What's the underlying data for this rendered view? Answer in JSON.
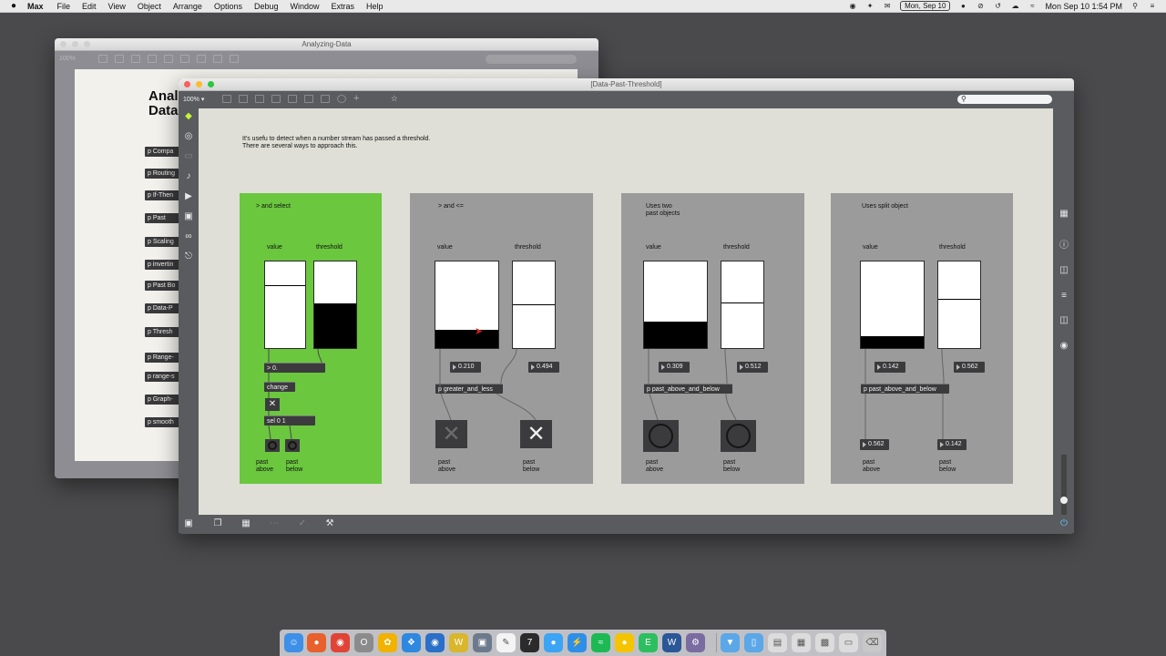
{
  "menubar": {
    "apple": "",
    "app": "Max",
    "items": [
      "File",
      "Edit",
      "View",
      "Object",
      "Arrange",
      "Options",
      "Debug",
      "Window",
      "Extras",
      "Help"
    ],
    "date_badge": "Mon, Sep 10",
    "clock": "Mon Sep 10  1:54 PM"
  },
  "bg_window": {
    "title": "Analyzing-Data",
    "zoom": "100%",
    "heading_line1": "Anal",
    "heading_line2": "Data",
    "objects": [
      "p Compa",
      "p Routing",
      "p If-Then",
      "p Past",
      "p Scaling",
      "p invertin",
      "p Past Bo",
      "p Data-P",
      "p Thresh",
      "p Range-",
      "p range-s",
      "p Graph-",
      "p smooth"
    ]
  },
  "main_window": {
    "title": "[Data-Past-Threshold]",
    "zoom": "100% ▾",
    "intro_line1": "It's usefu to detect when a number stream has passed a threshold.",
    "intro_line2": "There are several ways to approach this.",
    "panels": [
      {
        "title": "> and select",
        "value_label": "value",
        "threshold_label": "threshold",
        "value_level": 0.72,
        "threshold_level": 0.52,
        "gt_box": "> 0.",
        "change_box": "change",
        "toggle": "✕",
        "sel_box": "sel 0 1",
        "above_label": "past\nabove",
        "below_label": "past\nbelow"
      },
      {
        "title": "> and <=",
        "value_label": "value",
        "threshold_label": "threshold",
        "value_level": 0.21,
        "threshold_level": 0.494,
        "value_num": "0.210",
        "threshold_num": "0.494",
        "object": "p greater_and_less",
        "above_symbol": "✕",
        "below_symbol": "✕",
        "above_label": "past\nabove",
        "below_label": "past\nbelow"
      },
      {
        "title": "Uses two\npast objects",
        "value_label": "value",
        "threshold_label": "threshold",
        "value_level": 0.309,
        "threshold_level": 0.512,
        "value_num": "0.309",
        "threshold_num": "0.512",
        "object": "p past_above_and_below",
        "above_label": "past\nabove",
        "below_label": "past\nbelow"
      },
      {
        "title": "Uses split object",
        "value_label": "value",
        "threshold_label": "threshold",
        "value_level": 0.142,
        "threshold_level": 0.562,
        "value_num": "0.142",
        "threshold_num": "0.562",
        "object": "p past_above_and_below",
        "out_above": "0.562",
        "out_below": "0.142",
        "above_label": "past\nabove",
        "below_label": "past\nbelow"
      }
    ]
  },
  "colors": {
    "green_panel": "#6ac73e",
    "gray_panel": "#9a9b9a",
    "canvas": "#dfdfd7",
    "object": "#3b3b3d"
  },
  "dock": {
    "apps": [
      "finder-icon",
      "firefox-icon",
      "chrome-icon",
      "opera-icon",
      "photos-icon",
      "safari-icon",
      "browser-icon",
      "wunderlist-icon",
      "preview-icon",
      "textedit-icon",
      "max-icon",
      "messages-icon",
      "messenger-icon",
      "spotify-icon",
      "notes-icon",
      "evernote-icon",
      "word-icon",
      "settings-icon",
      "downloads-icon",
      "folder-icon",
      "files-icon",
      "grid-icon",
      "screen-icon",
      "window-icon",
      "trash-icon"
    ]
  }
}
